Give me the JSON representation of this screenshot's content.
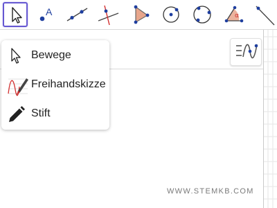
{
  "toolbar": {
    "tools": [
      {
        "icon": "move-arrow-icon"
      },
      {
        "icon": "point-icon",
        "glyph": "A"
      },
      {
        "icon": "line-icon"
      },
      {
        "icon": "perpendicular-line-icon"
      },
      {
        "icon": "polygon-icon"
      },
      {
        "icon": "circle-center-point-icon"
      },
      {
        "icon": "circle-three-points-icon"
      },
      {
        "icon": "angle-icon",
        "glyph": "α"
      },
      {
        "icon": "segment-icon"
      }
    ]
  },
  "menu": {
    "items": [
      {
        "label": "Bewege",
        "icon": "move-arrow-icon"
      },
      {
        "label": "Freihandskizze",
        "icon": "freehand-sketch-icon"
      },
      {
        "label": "Stift",
        "icon": "pen-icon"
      }
    ]
  },
  "watermark": "WWW.STEMKB.COM",
  "colors": {
    "accent": "#6557d2",
    "point": "#1f3f9f",
    "line": "#444444",
    "polygon_fill": "#e8a68c",
    "angle_red": "#d32f2f"
  }
}
